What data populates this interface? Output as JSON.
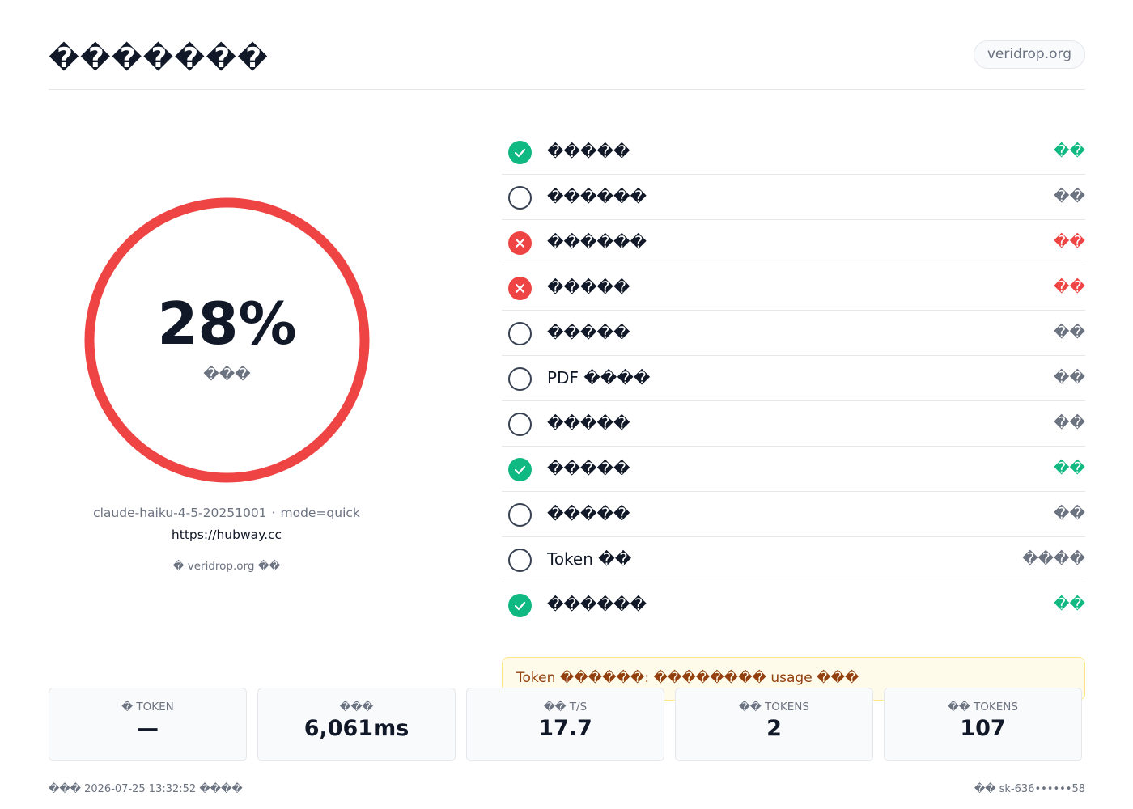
{
  "header": {
    "title": "�������",
    "domain": "veridrop.org"
  },
  "gauge": {
    "value": "28%",
    "fraction": 0.28,
    "label": "���",
    "color": "#ef4444"
  },
  "meta": {
    "model": "claude-haiku-4-5-20251001",
    "separator": "·",
    "mode": "mode=quick",
    "url": "https://hubway.cc",
    "credit": "� veridrop.org ��"
  },
  "checks": [
    {
      "name": "�����",
      "status": "pass",
      "status_label": "��"
    },
    {
      "name": "������",
      "status": "skip",
      "status_label": "��"
    },
    {
      "name": "������",
      "status": "fail",
      "status_label": "��"
    },
    {
      "name": "�����",
      "status": "fail",
      "status_label": "��"
    },
    {
      "name": "�����",
      "status": "skip",
      "status_label": "��"
    },
    {
      "name": "PDF ����",
      "status": "skip",
      "status_label": "��"
    },
    {
      "name": "�����",
      "status": "skip",
      "status_label": "��"
    },
    {
      "name": "�����",
      "status": "pass",
      "status_label": "��"
    },
    {
      "name": "�����",
      "status": "skip",
      "status_label": "��"
    },
    {
      "name": "Token ��",
      "status": "skip",
      "status_label": "����"
    },
    {
      "name": "������",
      "status": "pass",
      "status_label": "��"
    }
  ],
  "notice": "Token ������: �������� usage ���",
  "stats": [
    {
      "label": "� TOKEN",
      "value": "—"
    },
    {
      "label": "���",
      "value": "6,061ms"
    },
    {
      "label": "�� T/S",
      "value": "17.7"
    },
    {
      "label": "�� TOKENS",
      "value": "2"
    },
    {
      "label": "�� TOKENS",
      "value": "107"
    }
  ],
  "footer": {
    "left": "��� 2026-07-25 13:32:52 ����",
    "right": "�� sk-636••••••58"
  },
  "colors": {
    "pass": "#10b981",
    "fail": "#ef4444",
    "skip": "#6b7280"
  }
}
